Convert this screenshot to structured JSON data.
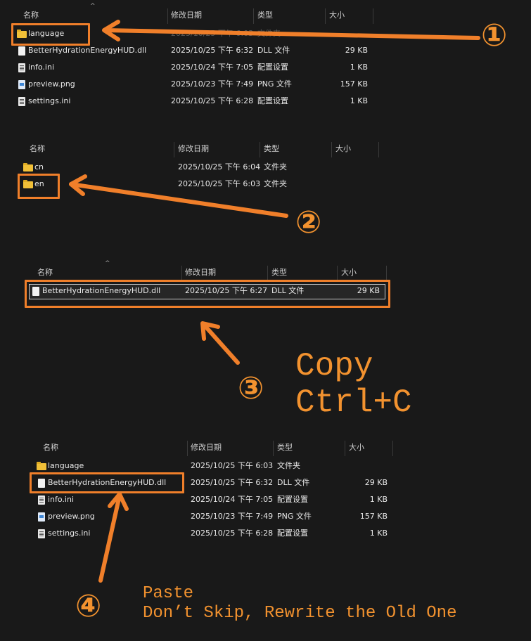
{
  "columns": {
    "name": "名称",
    "date": "修改日期",
    "type": "类型",
    "size": "大小"
  },
  "panel1": {
    "rows": [
      {
        "name": "language",
        "date": "2025/10/25 下午 6:03",
        "type": "文件夹",
        "size": "",
        "icon": "folder-icon"
      },
      {
        "name": "BetterHydrationEnergyHUD.dll",
        "date": "2025/10/25 下午 6:32",
        "type": "DLL 文件",
        "size": "29 KB",
        "icon": "dll-file-icon"
      },
      {
        "name": "info.ini",
        "date": "2025/10/24 下午 7:05",
        "type": "配置设置",
        "size": "1 KB",
        "icon": "config-file-icon"
      },
      {
        "name": "preview.png",
        "date": "2025/10/23 下午 7:49",
        "type": "PNG 文件",
        "size": "157 KB",
        "icon": "image-file-icon"
      },
      {
        "name": "settings.ini",
        "date": "2025/10/25 下午 6:28",
        "type": "配置设置",
        "size": "1 KB",
        "icon": "config-file-icon"
      }
    ]
  },
  "panel2": {
    "rows": [
      {
        "name": "cn",
        "date": "2025/10/25 下午 6:04",
        "type": "文件夹",
        "icon": "folder-icon"
      },
      {
        "name": "en",
        "date": "2025/10/25 下午 6:03",
        "type": "文件夹",
        "icon": "folder-icon"
      }
    ]
  },
  "panel3": {
    "rows": [
      {
        "name": "BetterHydrationEnergyHUD.dll",
        "date": "2025/10/25 下午 6:27",
        "type": "DLL 文件",
        "size": "29 KB",
        "icon": "dll-file-icon"
      }
    ]
  },
  "panel4": {
    "rows": [
      {
        "name": "language",
        "date": "2025/10/25 下午 6:03",
        "type": "文件夹",
        "size": "",
        "icon": "folder-icon"
      },
      {
        "name": "BetterHydrationEnergyHUD.dll",
        "date": "2025/10/25 下午 6:32",
        "type": "DLL 文件",
        "size": "29 KB",
        "icon": "dll-file-icon"
      },
      {
        "name": "info.ini",
        "date": "2025/10/24 下午 7:05",
        "type": "配置设置",
        "size": "1 KB",
        "icon": "config-file-icon"
      },
      {
        "name": "preview.png",
        "date": "2025/10/23 下午 7:49",
        "type": "PNG 文件",
        "size": "157 KB",
        "icon": "image-file-icon"
      },
      {
        "name": "settings.ini",
        "date": "2025/10/25 下午 6:28",
        "type": "配置设置",
        "size": "1 KB",
        "icon": "config-file-icon"
      }
    ]
  },
  "steps": {
    "s1": "①",
    "s2": "②",
    "s3": "③",
    "s4": "④",
    "copy_line1": "Copy",
    "copy_line2": "Ctrl+C",
    "paste_line1": "Paste",
    "paste_line2": "Don’t Skip, Rewrite the Old One"
  },
  "accent_color": "#f07f2a"
}
